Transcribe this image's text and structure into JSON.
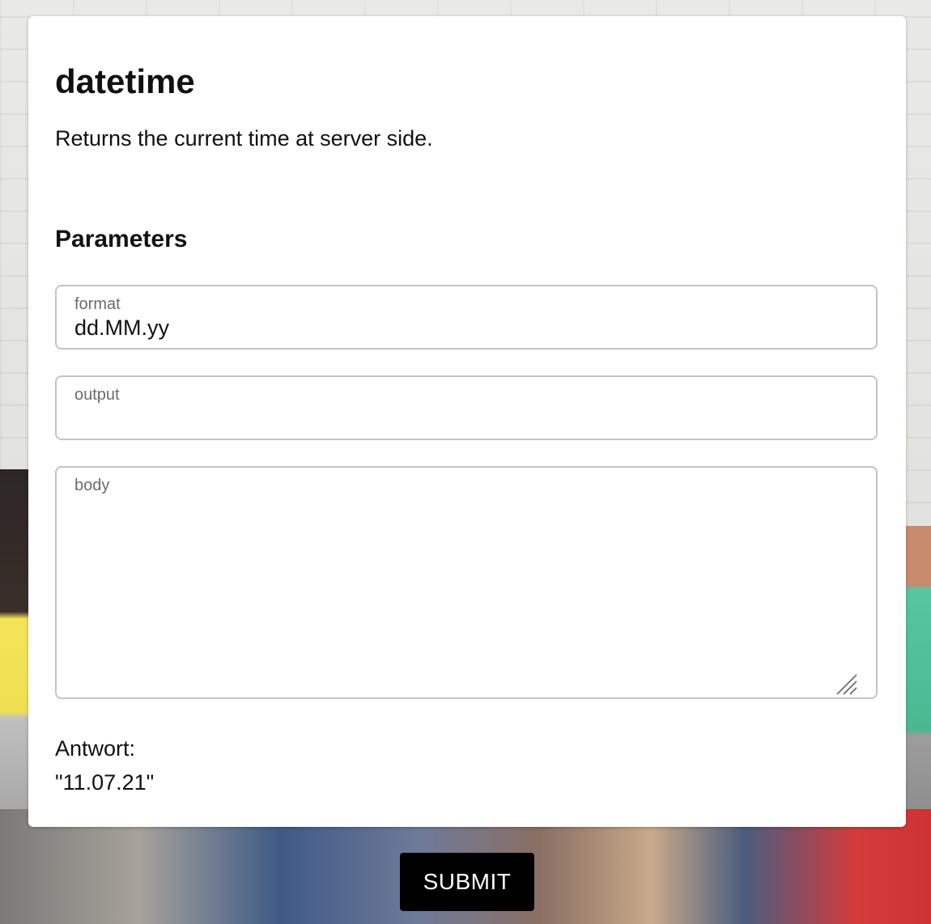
{
  "form": {
    "title": "datetime",
    "description": "Returns the current time at server side.",
    "parameters_heading": "Parameters",
    "fields": {
      "format": {
        "label": "format",
        "value": "dd.MM.yy"
      },
      "output": {
        "label": "output",
        "value": ""
      },
      "body": {
        "label": "body",
        "value": ""
      }
    },
    "answer_label": "Antwort:",
    "answer_value": "\"11.07.21\""
  },
  "submit_label": "SUBMIT",
  "colors": {
    "card_background": "#ffffff",
    "field_border": "#c4c4c4",
    "label_text": "#6b6b6b",
    "submit_background": "#000000",
    "submit_text": "#ffffff"
  }
}
